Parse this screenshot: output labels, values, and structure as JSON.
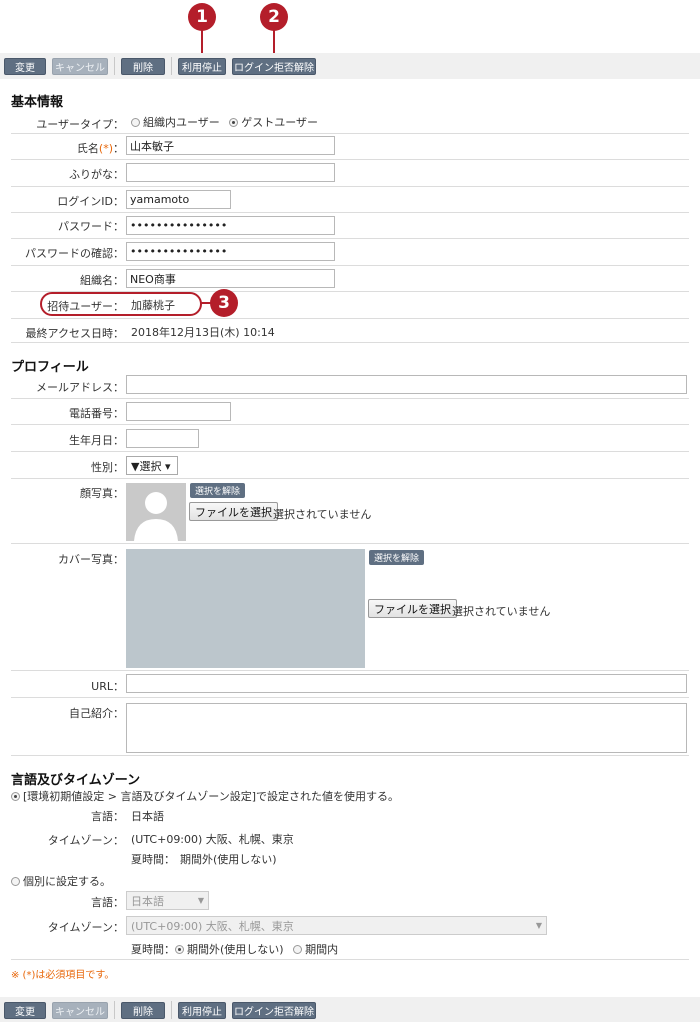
{
  "callouts": {
    "c1": "1",
    "c2": "2",
    "c3": "3"
  },
  "toolbar": {
    "change": "変更",
    "cancel": "キャンセル",
    "delete": "削除",
    "suspend": "利用停止",
    "unlock": "ログイン拒否解除"
  },
  "basic": {
    "title": "基本情報",
    "user_type_label": "ユーザータイプ：",
    "user_type_internal": "組織内ユーザー",
    "user_type_guest": "ゲストユーザー",
    "name_label": "氏名",
    "required_mark": "(*)",
    "colon": "：",
    "name_value": "山本敏子",
    "furigana_label": "ふりがな：",
    "furigana_value": "",
    "login_id_label": "ログインID：",
    "login_id_value": "yamamoto",
    "password_label": "パスワード：",
    "password_value": "•••••••••••••••",
    "password_confirm_label": "パスワードの確認：",
    "password_confirm_value": "•••••••••••••••",
    "org_label": "組織名：",
    "org_value": "NEO商事",
    "inviter_label": "招待ユーザー：",
    "inviter_value": "加藤桃子",
    "last_access_label": "最終アクセス日時：",
    "last_access_value": "2018年12月13日(木) 10:14"
  },
  "profile": {
    "title": "プロフィール",
    "email_label": "メールアドレス：",
    "phone_label": "電話番号：",
    "birthday_label": "生年月日：",
    "gender_label": "性別：",
    "gender_value": "▼選択 ▾",
    "photo_label": "顔写真：",
    "clear_selection": "選択を解除",
    "choose_file": "ファイルを選択",
    "no_file": "選択されていません",
    "cover_label": "カバー写真：",
    "url_label": "URL：",
    "intro_label": "自己紹介："
  },
  "locale": {
    "title": "言語及びタイムゾーン",
    "use_default": "[環境初期値設定 > 言語及びタイムゾーン設定]で設定された値を使用する。",
    "language_label": "言語：",
    "language_value": "日本語",
    "timezone_label": "タイムゾーン：",
    "timezone_value": "(UTC+09:00) 大阪、札幌、東京",
    "dst_label": "夏時間：",
    "dst_value": "期間外(使用しない)",
    "individual": "個別に設定する。",
    "language_select": "日本語",
    "timezone_select": "(UTC+09:00) 大阪、札幌、東京",
    "dst_off": "期間外(使用しない)",
    "dst_on": "期間内"
  },
  "footer_note": "※ (*)は必須項目です。"
}
